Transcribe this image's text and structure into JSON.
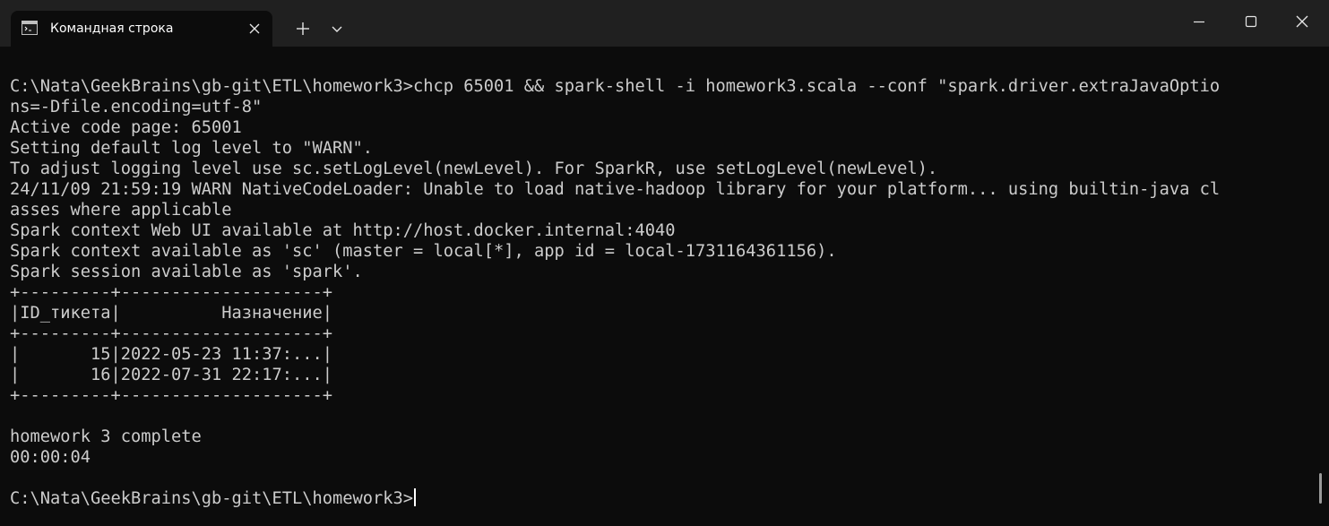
{
  "window": {
    "tab_title": "Командная строка",
    "colors": {
      "titlebar": "#202020",
      "terminal_background": "#0c0c0c",
      "terminal_text": "#cccccc"
    }
  },
  "icons": {
    "tab": "terminal-icon",
    "tab_close": "close-icon",
    "new_tab": "plus-icon",
    "dropdown": "chevron-down-icon",
    "minimize": "minimize-icon",
    "maximize": "maximize-icon",
    "close": "close-icon"
  },
  "terminal": {
    "lines": [
      "C:\\Nata\\GeekBrains\\gb-git\\ETL\\homework3>chcp 65001 && spark-shell -i homework3.scala --conf \"spark.driver.extraJavaOptio",
      "ns=-Dfile.encoding=utf-8\"",
      "Active code page: 65001",
      "Setting default log level to \"WARN\".",
      "To adjust logging level use sc.setLogLevel(newLevel). For SparkR, use setLogLevel(newLevel).",
      "24/11/09 21:59:19 WARN NativeCodeLoader: Unable to load native-hadoop library for your platform... using builtin-java cl",
      "asses where applicable",
      "Spark context Web UI available at http://host.docker.internal:4040",
      "Spark context available as 'sc' (master = local[*], app id = local-1731164361156).",
      "Spark session available as 'spark'.",
      "+---------+--------------------+",
      "|ID_тикета|          Назначение|",
      "+---------+--------------------+",
      "|       15|2022-05-23 11:37:...|",
      "|       16|2022-07-31 22:17:...|",
      "+---------+--------------------+",
      "",
      "homework 3 complete",
      "00:00:04",
      "",
      "C:\\Nata\\GeekBrains\\gb-git\\ETL\\homework3>"
    ]
  }
}
